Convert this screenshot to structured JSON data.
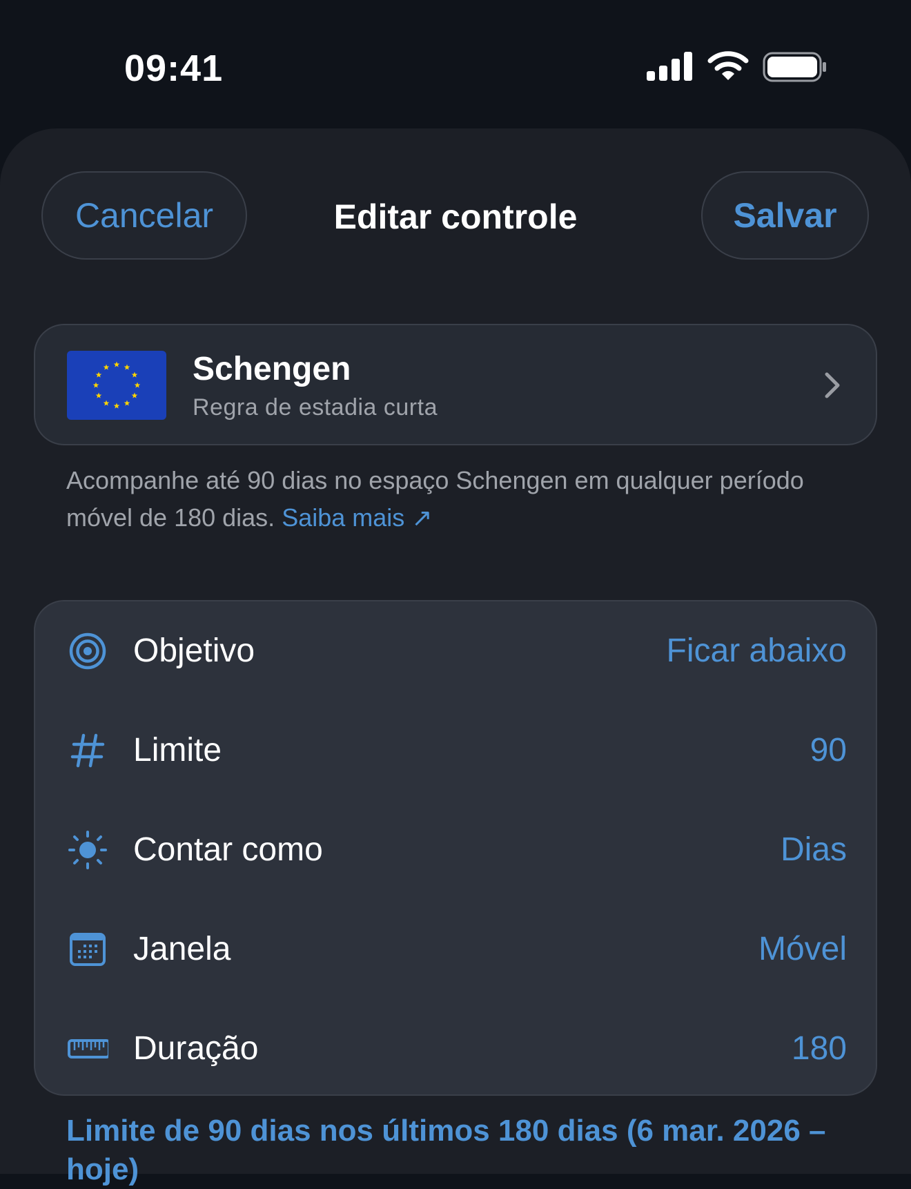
{
  "status_bar": {
    "time": "09:41"
  },
  "nav": {
    "cancel_label": "Cancelar",
    "title": "Editar controle",
    "save_label": "Salvar"
  },
  "tracker": {
    "title": "Schengen",
    "subtitle": "Regra de estadia curta",
    "flag_icon": "eu-flag-icon"
  },
  "description": {
    "text": "Acompanhe até 90 dias no espaço Schengen em qualquer período móvel de 180 dias.",
    "link_label": "Saiba mais ↗"
  },
  "settings": {
    "rows": [
      {
        "icon": "target-icon",
        "label": "Objetivo",
        "value": "Ficar abaixo"
      },
      {
        "icon": "hash-icon",
        "label": "Limite",
        "value": "90"
      },
      {
        "icon": "sun-icon",
        "label": "Contar como",
        "value": "Dias"
      },
      {
        "icon": "calendar-icon",
        "label": "Janela",
        "value": "Móvel"
      },
      {
        "icon": "ruler-icon",
        "label": "Duração",
        "value": "180"
      }
    ]
  },
  "summary": {
    "text": "Limite de 90 dias nos últimos 180 dias (6 mar. 2026 – hoje)"
  },
  "colors": {
    "accent": "#4e93d6",
    "background": "#0f131a",
    "sheet": "#1c1f26",
    "card": "#2d323c"
  }
}
